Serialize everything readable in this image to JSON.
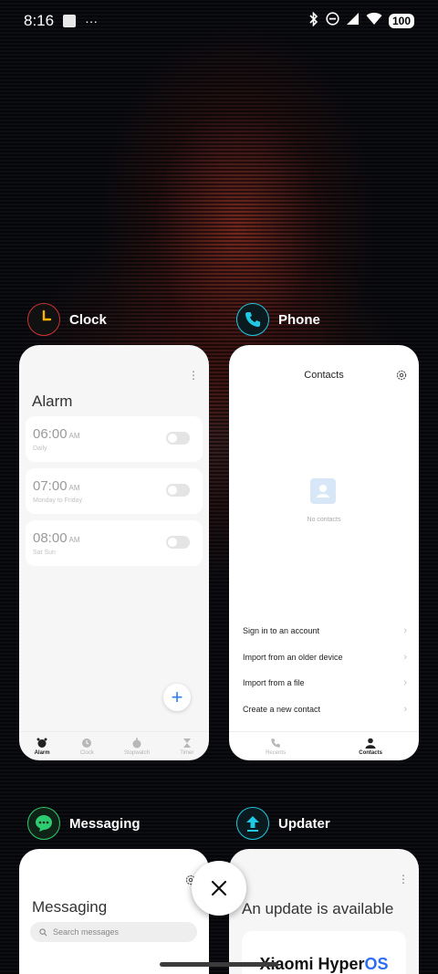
{
  "status_bar": {
    "time": "8:16",
    "more": "···",
    "battery": "100"
  },
  "apps": {
    "clock": {
      "name": "Clock",
      "alarm_title": "Alarm",
      "alarms": [
        {
          "time": "06:00",
          "ampm": "AM",
          "repeat": "Daily",
          "enabled": false
        },
        {
          "time": "07:00",
          "ampm": "AM",
          "repeat": "Monday to Friday",
          "enabled": false
        },
        {
          "time": "08:00",
          "ampm": "AM",
          "repeat": "Sat Sun",
          "enabled": false
        }
      ],
      "add_label": "+",
      "nav": [
        "Alarm",
        "Clock",
        "Stopwatch",
        "Timer"
      ],
      "nav_active": "Alarm"
    },
    "phone": {
      "name": "Phone",
      "title": "Contacts",
      "empty_text": "No contacts",
      "options": [
        "Sign in to an account",
        "Import from an older device",
        "Import from a file",
        "Create a new contact"
      ],
      "nav": [
        "Recents",
        "Contacts"
      ],
      "nav_active": "Contacts"
    },
    "messaging": {
      "name": "Messaging",
      "title": "Messaging",
      "search_placeholder": "Search messages"
    },
    "updater": {
      "name": "Updater",
      "title": "An update is available",
      "brand_main": "Xiaomi Hyper",
      "brand_os": "OS"
    }
  },
  "colors": {
    "clock_accent": "#ffb300",
    "phone_accent": "#1fc8e3",
    "messaging_accent": "#2ecc71",
    "updater_accent": "#1fc8e3",
    "fab_accent": "#2f7bf5"
  },
  "icons": {
    "clock": "clock-icon",
    "phone": "phone-icon",
    "messaging": "chat-bubble-icon",
    "updater": "upload-arrow-icon",
    "close": "close-icon"
  }
}
